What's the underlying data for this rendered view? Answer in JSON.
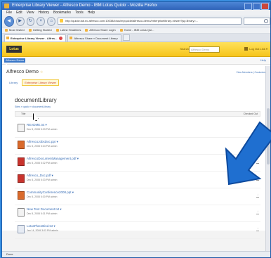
{
  "window": {
    "title": "Enterprise Library Viewer - Alfresco Demo - IBM Lotus Quickr - Mozilla Firefox",
    "menu": [
      "File",
      "Edit",
      "View",
      "History",
      "Bookmarks",
      "Tools",
      "Help"
    ]
  },
  "browser": {
    "url": "http://quickr.lab.ec.alfresco.com:10038/lotus/myquickr/alfresco-demo/enterpriselibrary-viewer?jsp.library=...",
    "bookmarks": [
      "Most Visited",
      "Getting Started",
      "Latest Headlines",
      "Alfresco Share Login",
      "Home - IBM Lotus Qui..."
    ],
    "tabs": [
      "Enterprise Library Viewer - Alfres...",
      "Alfresco Share » Document Library"
    ],
    "status": "Done"
  },
  "app": {
    "logo": "Lotus",
    "search_label": "Search",
    "search_placeholder": "Alfresco Demo",
    "header_links": "Log Out Link ▾",
    "site_menu": "Alfresco Demo ▾",
    "help": "Help"
  },
  "site": {
    "title": "Alfresco Demo",
    "links": "View Members  |  Customize",
    "nav": [
      "Library",
      "Enterprise Library Viewer"
    ]
  },
  "library": {
    "title": "documentLibrary",
    "breadcrumb": "Sites » quickr » documentLibrary",
    "toolbar_left": "Title",
    "toolbar_right": "Checked Out"
  },
  "files": [
    {
      "name": "README.txt ▾",
      "meta": "Dec 5, 2008 5:33 PM  admin",
      "type": "txt"
    },
    {
      "name": "AlfrescoJobsDoc.ppt ▾",
      "meta": "Dec 5, 2008 5:34 PM  admin",
      "type": "ppt"
    },
    {
      "name": "AlfrescoDocumentManagement.pdf ▾",
      "meta": "Dec 5, 2008 5:32 PM  admin",
      "type": "pdf"
    },
    {
      "name": "Alfresco_Doc.pdf ▾",
      "meta": "Dec 5, 2008 5:33 PM  admin",
      "type": "pdf"
    },
    {
      "name": "CommunityConference2008.ppt ▾",
      "meta": "Dec 5, 2008 5:30 PM  admin",
      "type": "ppt"
    },
    {
      "name": "New Text Document.txt ▾",
      "meta": "Dec 5, 2008 5:31 PM  admin",
      "type": "txt"
    },
    {
      "name": "LotusPlaceBind.txt ▾",
      "meta": "Jan 14, 2009 3:03 PM  admin",
      "type": "txt"
    }
  ],
  "colors": {
    "arrow": "#1f6fd0",
    "header": "#f6c51b",
    "link": "#3a6fb7"
  }
}
